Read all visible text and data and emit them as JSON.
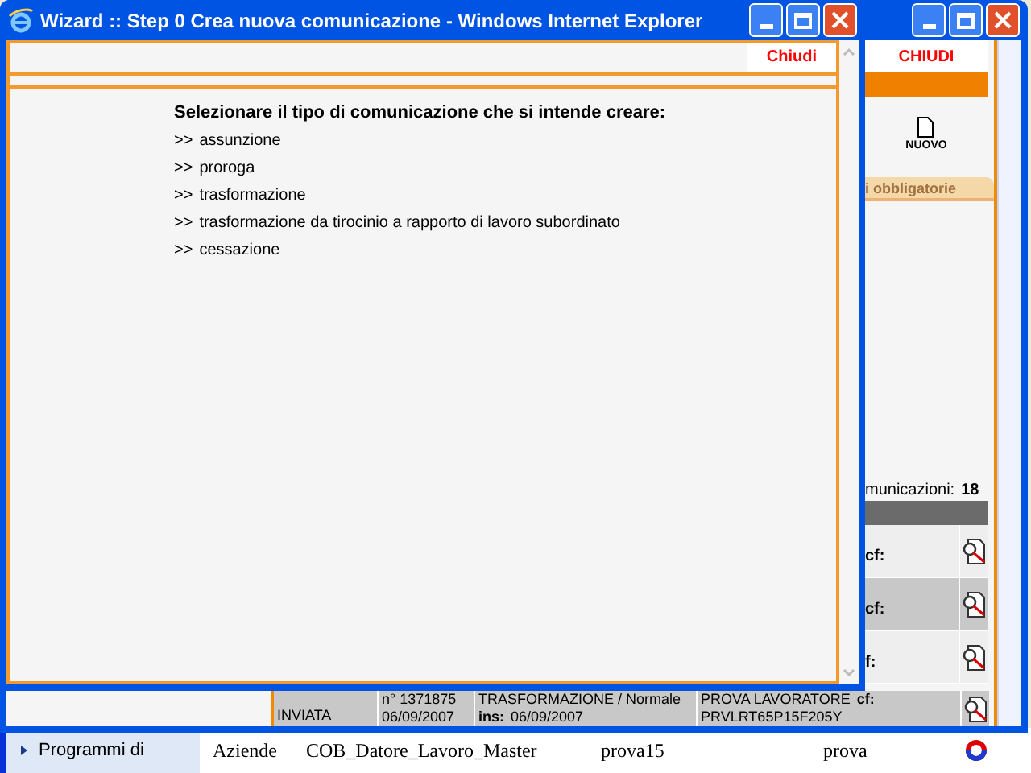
{
  "popup": {
    "title": "Wizard :: Step 0 Crea nuova comunicazione - Windows Internet Explorer",
    "close_link": "Chiudi",
    "heading": "Selezionare il tipo di comunicazione che si intende creare:",
    "options": [
      {
        "marker": ">>",
        "label": "assunzione"
      },
      {
        "marker": ">>",
        "label": "proroga"
      },
      {
        "marker": ">>",
        "label": "trasformazione"
      },
      {
        "marker": ">>",
        "label": "trasformazione da tirocinio a rapporto di lavoro subordinato"
      },
      {
        "marker": ">>",
        "label": "cessazione"
      }
    ]
  },
  "background_window": {
    "close_link": "CHIUDI",
    "new_button": "NUOVO",
    "tab": "i obbligatorie",
    "count_label": "municazioni:",
    "count": "18",
    "rows": [
      {
        "shaded": false,
        "text": "cf:"
      },
      {
        "shaded": true,
        "text": "cf:"
      },
      {
        "shaded": false,
        "text": "f:"
      }
    ],
    "last_row": {
      "shaded": true,
      "status": "INVIATA",
      "number": "n° 1371875",
      "date": "06/09/2007",
      "type": "TRASFORMAZIONE / Normale",
      "ins_label": "ins:",
      "ins_date": "06/09/2007",
      "worker": "PROVA LAVORATORE",
      "cf_label": "cf:",
      "cf": "PRVLRT65P15F205Y"
    }
  },
  "bottom_window": {
    "sidebar_item": "Programmi di",
    "cells": [
      "Aziende",
      "COB_Datore_Lavoro_Master",
      "prova15",
      "prova"
    ]
  }
}
